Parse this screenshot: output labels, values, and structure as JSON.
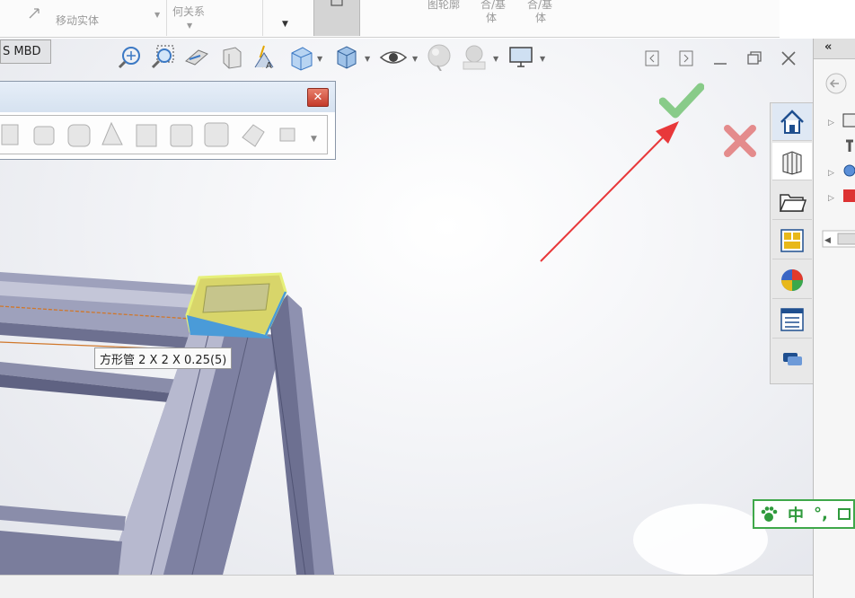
{
  "ribbon": {
    "move_body_label": "移动实体",
    "ref_geometry_label": "何关系",
    "right_labels": [
      "图轮廓",
      "合/基",
      "合/基"
    ],
    "right_sublabels": [
      "体",
      "体"
    ]
  },
  "viewport": {
    "mbd_tab_label": "S MBD",
    "hud_icons": [
      "zoom-to-fit-icon",
      "zoom-to-area-icon",
      "previous-view-icon",
      "section-view-icon",
      "dynamic-annotation-icon",
      "view-orientation-icon",
      "display-style-icon",
      "hide-show-items-icon",
      "edit-appearance-icon",
      "apply-scene-icon",
      "view-settings-icon"
    ]
  },
  "floating_toolbar": {
    "close_label": "✕"
  },
  "tooltip": {
    "text": "方形管 2 X 2 X 0.25(5)"
  },
  "right_panel": {
    "collapse_label": "«"
  },
  "ime": {
    "mode_label": "中",
    "punct_label": "°,"
  },
  "colors": {
    "accent_ok": "#7cc67c",
    "accent_cancel": "#e27a7a",
    "arrow": "#e8383a",
    "highlight": "#e6f07a",
    "frame": "#a6a8c2",
    "ime_green": "#3fa84a"
  }
}
